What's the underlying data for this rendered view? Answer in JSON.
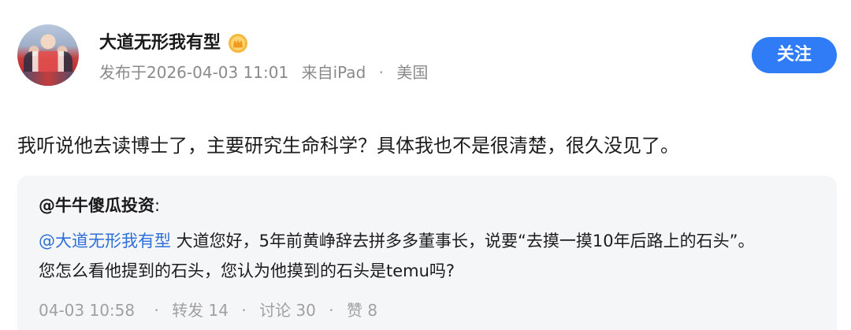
{
  "post": {
    "username": "大道无形我有型",
    "vip_icon": "vip-crown-badge-icon",
    "meta": {
      "posted_at": "发布于2026-04-03 11:01",
      "source": "来自iPad",
      "separator": "·",
      "location": "美国"
    },
    "follow_label": "关注",
    "text": "我听说他去读博士了，主要研究生命科学？具体我也不是很清楚，很久没见了。"
  },
  "quote": {
    "author": "@牛牛傻瓜投资",
    "author_suffix": ":",
    "mention": "@大道无形我有型",
    "body_line1": " 大道您好，5年前黄峥辞去拼多多董事长，说要“去摸一摸10年后路上的石头”。",
    "body_line2": "您怎么看他提到的石头，您认为他摸到的石头是temu吗?",
    "footer": {
      "time": "04-03 10:58",
      "separator": "·",
      "repost": "转发 14",
      "comment": "讨论 30",
      "like": "赞 8"
    }
  },
  "colors": {
    "accent": "#2f7cf6",
    "mention": "#2f6fd8",
    "muted": "#8a8a8a",
    "quote_bg": "#f5f6f8"
  }
}
